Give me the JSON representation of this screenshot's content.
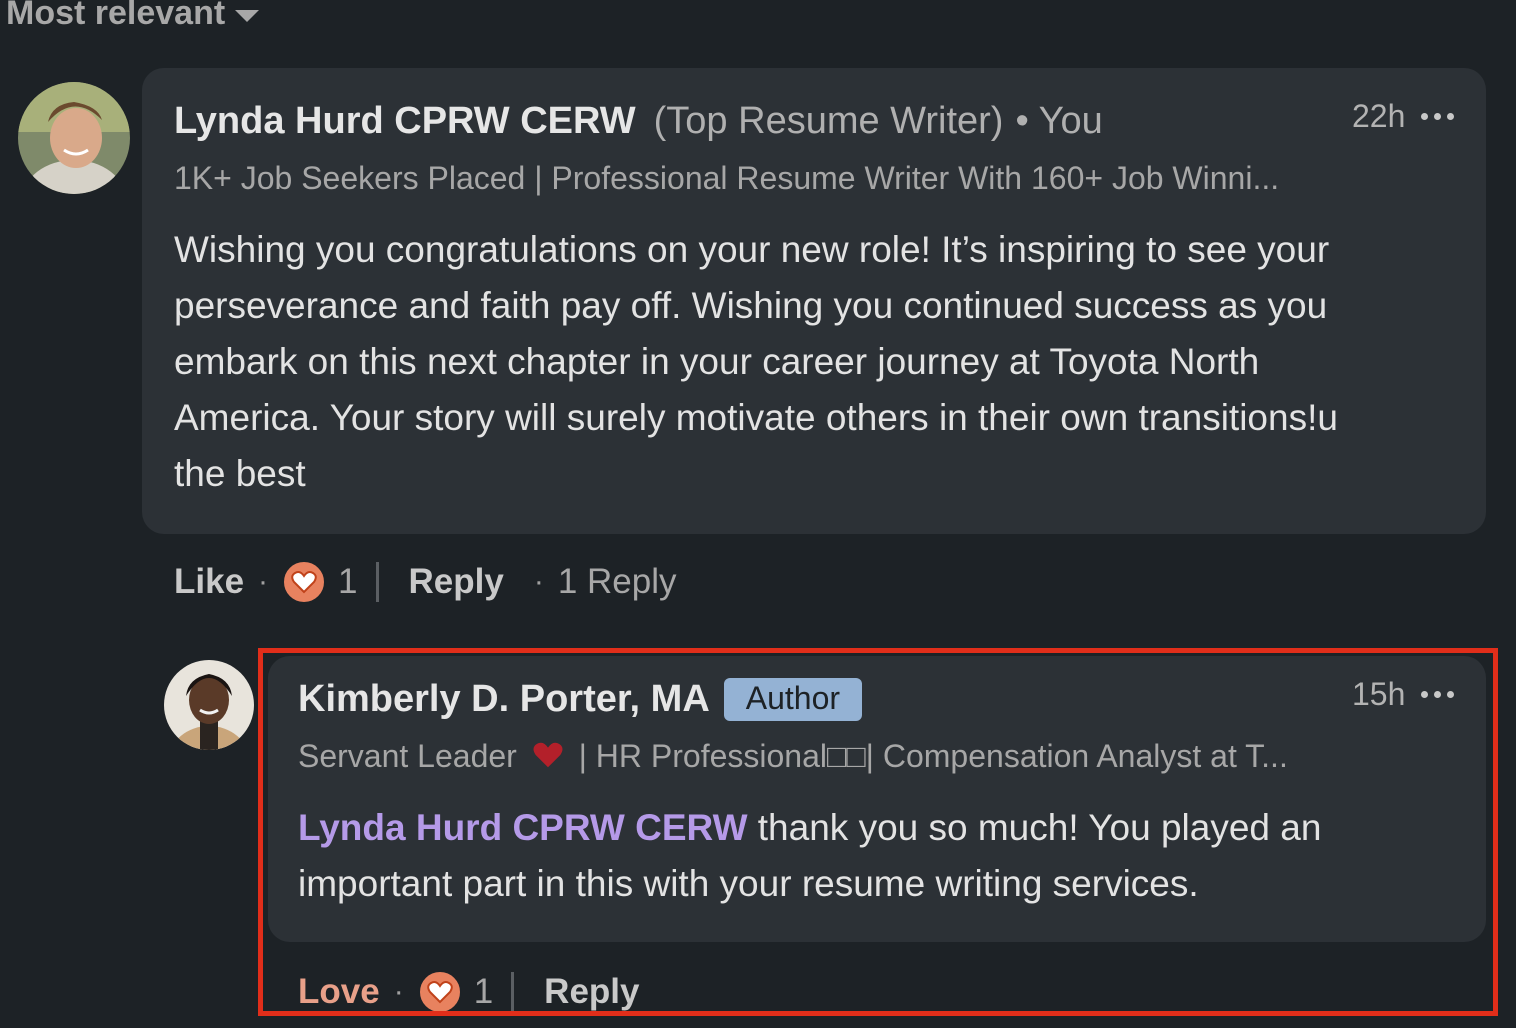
{
  "sort": {
    "label": "Most relevant"
  },
  "comment": {
    "author": "Lynda Hurd CPRW CERW",
    "badge": "(Top Resume Writer)",
    "relation": "• You",
    "headline": "1K+ Job Seekers Placed | Professional Resume Writer With 160+ Job Winni...",
    "time": "22h",
    "lines": [
      "Wishing you congratulations on your new role! It’s inspiring to see your",
      "perseverance and faith pay off. Wishing you continued success as you",
      "embark on this next chapter in your career journey at Toyota North",
      "America. Your story will surely motivate others in their own transitions!u",
      "the best"
    ],
    "actions": {
      "like_label": "Like",
      "reaction_count": "1",
      "reply_label": "Reply",
      "replies_label": "1 Reply"
    }
  },
  "reply": {
    "author": "Kimberly D. Porter, MA",
    "badge": "Author",
    "headline_prefix": "Servant Leader",
    "headline_suffix": "| HR Professional□□| Compensation Analyst at T...",
    "time": "15h",
    "mention": "Lynda Hurd CPRW CERW",
    "text_line1": " thank you so much! You played an",
    "text_line2": "important part in this with your resume writing services.",
    "actions": {
      "love_label": "Love",
      "reaction_count": "1",
      "reply_label": "Reply"
    }
  },
  "colors": {
    "background": "#1d2226",
    "bubble": "#2c3136",
    "mention": "#b59ae8",
    "love": "#e8a089",
    "highlight": "#e12e1a"
  }
}
